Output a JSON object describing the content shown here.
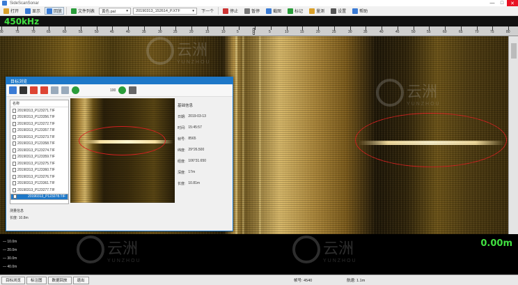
{
  "app": {
    "title": "SideScanSonar"
  },
  "toolbar": {
    "items": [
      {
        "label": "打开",
        "color": "#d9a02a"
      },
      {
        "label": "显示",
        "color": "#3a7bd5"
      },
      {
        "label": "回放",
        "color": "#3a7bd5"
      },
      {
        "label": "文件列表",
        "color": "#2a9d3a"
      }
    ],
    "file_select": "20190313_152614_P.XTF",
    "palette_select": "黄色.pal",
    "next_label": "下一个",
    "actions": [
      "停止",
      "暂停",
      "截图",
      "标记",
      "量测",
      "设置",
      "帮助"
    ],
    "window_controls": {
      "min": "—",
      "max": "□",
      "close": "✕"
    }
  },
  "viewer": {
    "frequency": "450kHz",
    "ruler_ticks": [
      "80",
      "75",
      "70",
      "65",
      "60",
      "55",
      "50",
      "45",
      "40",
      "35",
      "30",
      "25",
      "20",
      "15",
      "10",
      "5",
      "0",
      "5",
      "10",
      "15",
      "20",
      "25",
      "30",
      "35",
      "40",
      "45",
      "50",
      "55",
      "60",
      "65",
      "70",
      "75",
      "80"
    ]
  },
  "dialog": {
    "title": "目标浏览",
    "zoom_value": "100",
    "list_header": "名称",
    "files": [
      "20190313_P123271.TIF",
      "20190313_P123356.TIF",
      "20190313_P123272.TIF",
      "20190313_P123357.TIF",
      "20190313_P123273.TIF",
      "20190313_P123358.TIF",
      "20190313_P123274.TIF",
      "20190313_P123359.TIF",
      "20190313_P123275.TIF",
      "20190313_P123360.TIF",
      "20190313_P123276.TIF",
      "20190313_P123361.TIF",
      "20190313_P123277.TIF",
      "20190313_P123278.TIF"
    ],
    "selected_index": 13,
    "props_header": "基础信息",
    "props": [
      {
        "k": "日期:",
        "v": "2019-03-13"
      },
      {
        "k": "时间:",
        "v": "15:45:57"
      },
      {
        "k": "帧号:",
        "v": "8565"
      },
      {
        "k": "纬度:",
        "v": "29°26.500"
      },
      {
        "k": "经度:",
        "v": "106°31.650"
      },
      {
        "k": "深度:",
        "v": "17m"
      },
      {
        "k": "长度:",
        "v": "10.81m"
      }
    ],
    "bottom_header": "测量信息",
    "bottom_line": "长度:   10.8m"
  },
  "depth": {
    "rows": [
      "— 10.0m",
      "— 20.0m",
      "— 30.0m",
      "— 40.0m"
    ],
    "current": "0.00m"
  },
  "status": {
    "buttons": [
      "目标浏览",
      "标注图",
      "数据回放",
      "退出"
    ],
    "frame": "帧号:   4540",
    "speed": "航速:   1.1m"
  },
  "watermark": {
    "cn": "云洲",
    "en": "YUNZHOU"
  }
}
